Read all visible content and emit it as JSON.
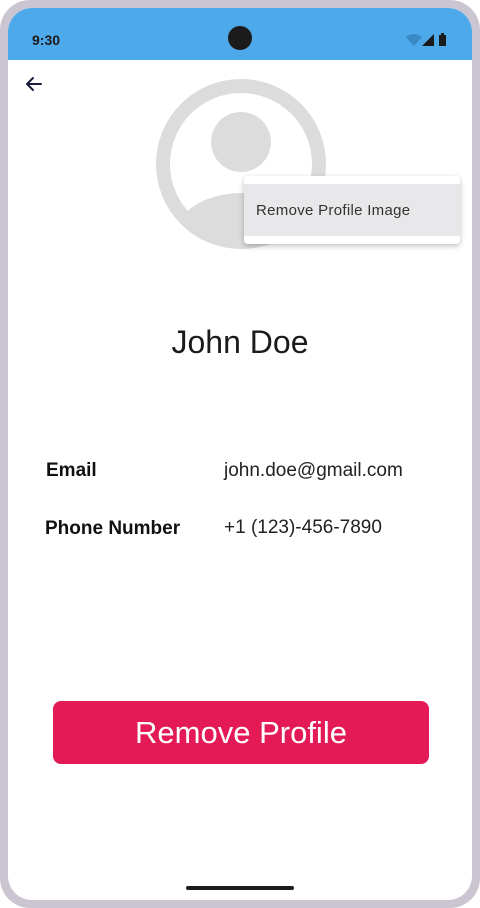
{
  "status_bar": {
    "time": "9:30",
    "icons": [
      "wifi-icon",
      "signal-icon",
      "battery-icon"
    ],
    "color": "#4da9ea"
  },
  "nav": {
    "back_icon": "arrow-back-icon"
  },
  "avatar": {
    "icon": "person-placeholder-icon"
  },
  "menu": {
    "items": [
      {
        "label": "Remove Profile Image"
      }
    ]
  },
  "profile": {
    "name": "John Doe",
    "fields": [
      {
        "label": "Email",
        "value": "john.doe@gmail.com"
      },
      {
        "label": "Phone Number",
        "value": "+1 (123)-456-7890"
      }
    ]
  },
  "actions": {
    "remove_profile_label": "Remove Profile",
    "remove_profile_color": "#e31a56"
  }
}
